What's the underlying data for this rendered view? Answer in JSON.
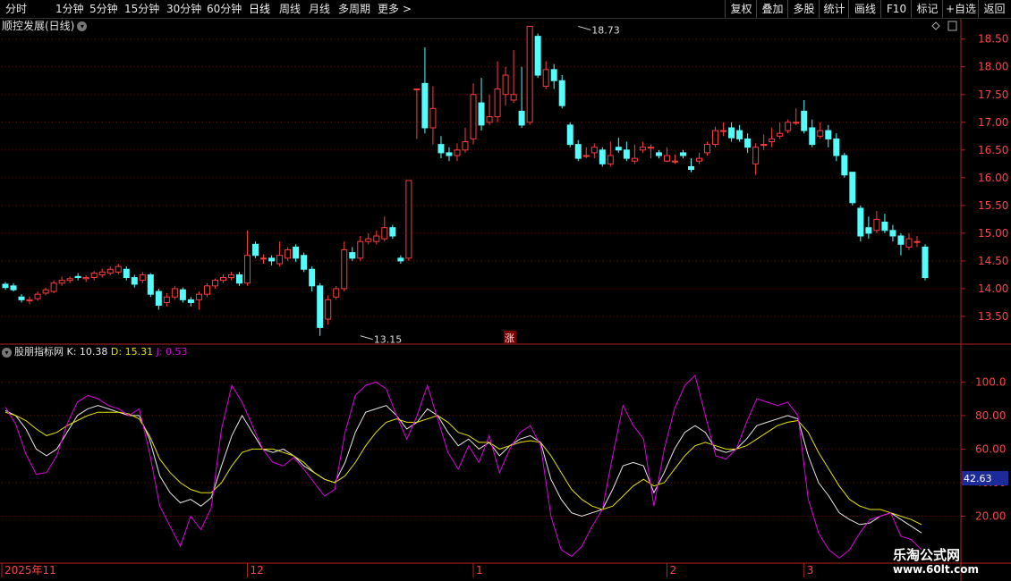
{
  "toolbar": {
    "periods": [
      "分时",
      "1分钟",
      "5分钟",
      "15分钟",
      "30分钟",
      "60分钟",
      "日线",
      "周线",
      "月线",
      "多周期",
      "更多 >"
    ],
    "active_period": "日线",
    "buttons": [
      "复权",
      "叠加",
      "多股",
      "统计",
      "画线",
      "F10",
      "标记",
      "+自选",
      "返回"
    ]
  },
  "chart_title": "顺控发展(日线)",
  "indicator": {
    "name": "股朋指标网",
    "k_label": "K: 10.38",
    "d_label": "D: 15.31",
    "j_label": "J: 0.53"
  },
  "rise_marker": "涨",
  "watermark": {
    "line1": "乐淘公式网",
    "line2": "www.60lt.com"
  },
  "colors": {
    "up": "#ff3b3b",
    "down": "#54fcfc",
    "k": "#e8e8e8",
    "d": "#e6e600",
    "j": "#e000e0",
    "axis": "#b22222",
    "grid": "#5a1010"
  },
  "chart_data": [
    {
      "type": "candlestick",
      "title": "顺控发展(日线)",
      "ylim": [
        13.0,
        18.85
      ],
      "yticks": [
        "18.50",
        "18.00",
        "17.50",
        "17.00",
        "16.50",
        "16.00",
        "15.50",
        "15.00",
        "14.50",
        "14.00",
        "13.50"
      ],
      "annotations": [
        {
          "label": "18.73",
          "price": 18.73,
          "index": 71
        },
        {
          "label": "13.15",
          "price": 13.15,
          "index": 44
        }
      ],
      "x_labels": [
        {
          "label": "2025年11",
          "index": 0
        },
        {
          "label": "12",
          "index": 30
        },
        {
          "label": "1",
          "index": 58
        },
        {
          "label": "2",
          "index": 82
        },
        {
          "label": "3",
          "index": 99
        }
      ],
      "candles": [
        [
          14.08,
          14.02,
          14.12,
          13.98
        ],
        [
          14.05,
          13.98,
          14.1,
          13.95
        ],
        [
          13.85,
          13.8,
          13.9,
          13.75
        ],
        [
          13.78,
          13.8,
          13.86,
          13.72
        ],
        [
          13.82,
          13.9,
          13.95,
          13.78
        ],
        [
          13.92,
          13.98,
          14.02,
          13.88
        ],
        [
          13.95,
          14.1,
          14.15,
          13.92
        ],
        [
          14.1,
          14.15,
          14.22,
          14.05
        ],
        [
          14.15,
          14.18,
          14.22,
          14.1
        ],
        [
          14.22,
          14.2,
          14.28,
          14.15
        ],
        [
          14.18,
          14.2,
          14.24,
          14.12
        ],
        [
          14.2,
          14.28,
          14.32,
          14.15
        ],
        [
          14.25,
          14.3,
          14.36,
          14.2
        ],
        [
          14.28,
          14.35,
          14.4,
          14.24
        ],
        [
          14.3,
          14.4,
          14.45,
          14.26
        ],
        [
          14.35,
          14.2,
          14.4,
          14.15
        ],
        [
          14.2,
          14.08,
          14.25,
          14.02
        ],
        [
          14.15,
          14.25,
          14.3,
          14.1
        ],
        [
          14.25,
          13.9,
          14.28,
          13.85
        ],
        [
          13.95,
          13.7,
          14.0,
          13.62
        ],
        [
          13.75,
          13.85,
          13.92,
          13.68
        ],
        [
          13.85,
          14.0,
          14.05,
          13.8
        ],
        [
          13.98,
          13.8,
          14.02,
          13.75
        ],
        [
          13.8,
          13.75,
          13.85,
          13.68
        ],
        [
          13.8,
          13.9,
          13.95,
          13.62
        ],
        [
          13.9,
          14.05,
          14.1,
          13.85
        ],
        [
          14.05,
          14.15,
          14.18,
          14.0
        ],
        [
          14.15,
          14.2,
          14.26,
          14.1
        ],
        [
          14.2,
          14.25,
          14.3,
          14.15
        ],
        [
          14.25,
          14.1,
          14.3,
          14.05
        ],
        [
          14.1,
          14.6,
          15.05,
          14.05
        ],
        [
          14.8,
          14.6,
          14.85,
          14.55
        ],
        [
          14.55,
          14.55,
          14.62,
          14.45
        ],
        [
          14.55,
          14.5,
          14.6,
          14.42
        ],
        [
          14.45,
          14.6,
          14.85,
          14.4
        ],
        [
          14.55,
          14.7,
          14.75,
          14.5
        ],
        [
          14.75,
          14.55,
          14.8,
          14.48
        ],
        [
          14.6,
          14.35,
          14.65,
          14.3
        ],
        [
          14.35,
          14.05,
          14.4,
          13.95
        ],
        [
          14.05,
          13.3,
          14.1,
          13.15
        ],
        [
          13.45,
          13.8,
          13.88,
          13.35
        ],
        [
          13.85,
          14.0,
          14.05,
          13.8
        ],
        [
          14.0,
          14.7,
          14.85,
          13.95
        ],
        [
          14.65,
          14.55,
          14.75,
          14.5
        ],
        [
          14.55,
          14.85,
          14.95,
          14.5
        ],
        [
          14.85,
          14.9,
          15.0,
          14.8
        ],
        [
          14.85,
          14.95,
          15.05,
          14.8
        ],
        [
          14.9,
          15.1,
          15.3,
          14.85
        ],
        [
          15.1,
          14.95,
          15.15,
          14.9
        ],
        [
          14.55,
          14.5,
          14.6,
          14.45
        ],
        [
          14.55,
          15.95,
          15.95,
          14.5
        ],
        [
          17.6,
          17.6,
          17.6,
          16.7
        ],
        [
          17.7,
          16.9,
          18.35,
          16.8
        ],
        [
          16.9,
          17.25,
          17.65,
          16.6
        ],
        [
          16.6,
          16.45,
          16.75,
          16.35
        ],
        [
          16.45,
          16.4,
          16.55,
          16.3
        ],
        [
          16.4,
          16.5,
          16.62,
          16.3
        ],
        [
          16.5,
          16.65,
          16.9,
          16.45
        ],
        [
          16.7,
          17.5,
          17.7,
          16.6
        ],
        [
          17.35,
          16.95,
          17.8,
          16.85
        ],
        [
          17.0,
          17.1,
          17.5,
          16.95
        ],
        [
          17.1,
          17.6,
          18.1,
          17.0
        ],
        [
          17.5,
          17.85,
          18.0,
          17.3
        ],
        [
          17.4,
          17.5,
          18.3,
          17.35
        ],
        [
          17.2,
          16.95,
          18.0,
          16.9
        ],
        [
          17.0,
          18.73,
          18.73,
          16.95
        ],
        [
          18.55,
          17.85,
          18.6,
          17.8
        ],
        [
          17.65,
          17.95,
          18.1,
          17.6
        ],
        [
          17.95,
          17.75,
          18.05,
          17.6
        ],
        [
          17.75,
          17.3,
          17.85,
          17.25
        ],
        [
          16.95,
          16.6,
          17.0,
          16.55
        ],
        [
          16.6,
          16.35,
          16.68,
          16.3
        ],
        [
          16.4,
          16.4,
          16.55,
          16.35
        ],
        [
          16.45,
          16.55,
          16.62,
          16.35
        ],
        [
          16.5,
          16.25,
          16.55,
          16.2
        ],
        [
          16.25,
          16.4,
          16.65,
          16.2
        ],
        [
          16.55,
          16.5,
          16.72,
          16.45
        ],
        [
          16.5,
          16.35,
          16.65,
          16.3
        ],
        [
          16.3,
          16.35,
          16.6,
          16.25
        ],
        [
          16.5,
          16.55,
          16.65,
          16.45
        ],
        [
          16.55,
          16.55,
          16.6,
          16.35
        ],
        [
          16.45,
          16.4,
          16.5,
          16.35
        ],
        [
          16.3,
          16.4,
          16.55,
          16.28
        ],
        [
          16.3,
          16.3,
          16.42,
          16.25
        ],
        [
          16.45,
          16.4,
          16.5,
          16.35
        ],
        [
          16.2,
          16.15,
          16.35,
          16.1
        ],
        [
          16.3,
          16.35,
          16.45,
          16.25
        ],
        [
          16.45,
          16.6,
          16.65,
          16.4
        ],
        [
          16.6,
          16.85,
          16.92,
          16.55
        ],
        [
          16.85,
          16.85,
          17.0,
          16.75
        ],
        [
          16.9,
          16.72,
          17.0,
          16.65
        ],
        [
          16.85,
          16.7,
          16.95,
          16.65
        ],
        [
          16.7,
          16.55,
          16.8,
          16.45
        ],
        [
          16.25,
          16.55,
          16.62,
          16.05
        ],
        [
          16.6,
          16.6,
          16.78,
          16.5
        ],
        [
          16.65,
          16.7,
          16.9,
          16.55
        ],
        [
          16.75,
          16.8,
          17.0,
          16.7
        ],
        [
          16.85,
          17.0,
          17.05,
          16.8
        ],
        [
          17.0,
          17.0,
          17.25,
          16.95
        ],
        [
          17.2,
          16.85,
          17.4,
          16.8
        ],
        [
          16.9,
          16.6,
          17.05,
          16.55
        ],
        [
          16.75,
          16.85,
          17.0,
          16.7
        ],
        [
          16.85,
          16.7,
          16.95,
          16.55
        ],
        [
          16.7,
          16.4,
          16.8,
          16.3
        ],
        [
          16.4,
          16.05,
          16.45,
          16.0
        ],
        [
          16.1,
          15.55,
          16.1,
          15.5
        ],
        [
          15.45,
          14.95,
          15.5,
          14.85
        ],
        [
          15.1,
          15.0,
          15.3,
          14.9
        ],
        [
          15.05,
          15.25,
          15.4,
          15.0
        ],
        [
          15.2,
          15.05,
          15.35,
          15.0
        ],
        [
          15.05,
          14.95,
          15.15,
          14.85
        ],
        [
          14.95,
          14.8,
          15.0,
          14.6
        ],
        [
          14.75,
          14.9,
          15.0,
          14.7
        ],
        [
          14.85,
          14.85,
          14.95,
          14.75
        ],
        [
          14.75,
          14.2,
          14.8,
          14.15
        ]
      ]
    },
    {
      "type": "line",
      "title": "股朋指标网",
      "ylim": [
        -8,
        113
      ],
      "yticks": [
        "100.0",
        "80.00",
        "60.00",
        "40.00",
        "20.00"
      ],
      "cursor_value": "42.63",
      "series": [
        {
          "name": "K",
          "values": [
            83,
            80,
            72,
            60,
            56,
            60,
            70,
            80,
            84,
            86,
            84,
            82,
            80,
            80,
            66,
            44,
            34,
            28,
            30,
            26,
            31,
            50,
            68,
            80,
            70,
            60,
            58,
            60,
            56,
            50,
            46,
            42,
            40,
            52,
            70,
            82,
            84,
            86,
            80,
            72,
            76,
            84,
            80,
            70,
            62,
            66,
            60,
            64,
            56,
            62,
            66,
            68,
            64,
            42,
            30,
            22,
            20,
            22,
            24,
            36,
            50,
            52,
            50,
            34,
            46,
            60,
            70,
            74,
            70,
            60,
            58,
            60,
            66,
            74,
            76,
            78,
            80,
            78,
            56,
            40,
            32,
            22,
            18,
            15,
            16,
            20,
            22,
            18,
            14,
            10
          ]
        },
        {
          "name": "D",
          "values": [
            82,
            80,
            77,
            72,
            68,
            70,
            74,
            77,
            80,
            82,
            82,
            82,
            81,
            78,
            68,
            54,
            46,
            40,
            36,
            34,
            34,
            40,
            50,
            58,
            60,
            60,
            60,
            58,
            56,
            52,
            46,
            42,
            40,
            44,
            52,
            62,
            70,
            76,
            78,
            76,
            76,
            78,
            80,
            76,
            70,
            68,
            64,
            64,
            60,
            62,
            64,
            65,
            64,
            56,
            46,
            36,
            30,
            26,
            24,
            26,
            32,
            38,
            42,
            38,
            40,
            48,
            56,
            62,
            64,
            62,
            60,
            60,
            62,
            66,
            70,
            74,
            76,
            77,
            70,
            58,
            48,
            38,
            30,
            26,
            24,
            24,
            22,
            20,
            18,
            15
          ]
        },
        {
          "name": "J",
          "values": [
            85,
            75,
            57,
            45,
            46,
            56,
            75,
            88,
            92,
            90,
            86,
            84,
            80,
            84,
            58,
            26,
            14,
            2,
            20,
            12,
            25,
            72,
            98,
            88,
            74,
            60,
            52,
            50,
            55,
            48,
            40,
            32,
            36,
            70,
            92,
            98,
            100,
            96,
            80,
            66,
            80,
            98,
            78,
            58,
            48,
            62,
            52,
            68,
            46,
            60,
            70,
            74,
            62,
            20,
            0,
            -4,
            2,
            14,
            24,
            56,
            86,
            74,
            66,
            26,
            60,
            84,
            98,
            104,
            80,
            56,
            54,
            60,
            76,
            90,
            88,
            86,
            88,
            80,
            30,
            10,
            0,
            -5,
            0,
            10,
            18,
            20,
            22,
            8,
            6,
            0
          ]
        }
      ]
    }
  ]
}
